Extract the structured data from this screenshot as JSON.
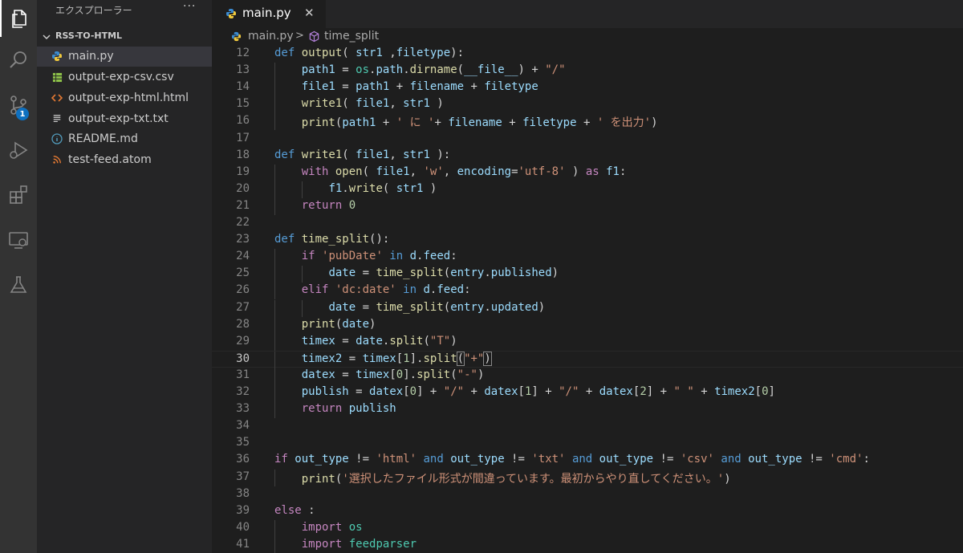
{
  "sidebar": {
    "title": "エクスプローラー",
    "more": "···",
    "folder": "RSS-TO-HTML",
    "files": [
      {
        "name": "main.py",
        "icon": "python-icon",
        "selected": true
      },
      {
        "name": "output-exp-csv.csv",
        "icon": "csv-icon"
      },
      {
        "name": "output-exp-html.html",
        "icon": "html-icon"
      },
      {
        "name": "output-exp-txt.txt",
        "icon": "text-file-icon"
      },
      {
        "name": "README.md",
        "icon": "info-icon"
      },
      {
        "name": "test-feed.atom",
        "icon": "rss-icon"
      }
    ]
  },
  "activity": {
    "scm_badge": "1",
    "items": [
      "explorer-icon",
      "search-icon",
      "source-control-icon",
      "run-debug-icon",
      "extensions-icon",
      "remote-explorer-icon",
      "testing-icon"
    ]
  },
  "tab": {
    "label": "main.py",
    "close": "✕"
  },
  "breadcrumb": {
    "file": "main.py",
    "separator": ">",
    "symbol": "time_split"
  },
  "editor": {
    "current_line": 30,
    "lines": [
      {
        "n": "12",
        "indent": 0,
        "tokens": [
          [
            "kw",
            "def "
          ],
          [
            "fn",
            "output"
          ],
          [
            "df",
            "( "
          ],
          [
            "vr",
            "str1"
          ],
          [
            "df",
            " ,"
          ],
          [
            "vr",
            "filetype"
          ],
          [
            "df",
            "):"
          ]
        ]
      },
      {
        "n": "13",
        "indent": 1,
        "tokens": [
          [
            "vr",
            "path1"
          ],
          [
            "df",
            " = "
          ],
          [
            "cls",
            "os"
          ],
          [
            "df",
            "."
          ],
          [
            "vr",
            "path"
          ],
          [
            "df",
            "."
          ],
          [
            "fn",
            "dirname"
          ],
          [
            "df",
            "("
          ],
          [
            "vr",
            "__file__"
          ],
          [
            "df",
            ") + "
          ],
          [
            "st",
            "\"/\""
          ]
        ]
      },
      {
        "n": "14",
        "indent": 1,
        "tokens": [
          [
            "vr",
            "file1"
          ],
          [
            "df",
            " = "
          ],
          [
            "vr",
            "path1"
          ],
          [
            "df",
            " + "
          ],
          [
            "vr",
            "filename"
          ],
          [
            "df",
            " + "
          ],
          [
            "vr",
            "filetype"
          ]
        ]
      },
      {
        "n": "15",
        "indent": 1,
        "tokens": [
          [
            "fn",
            "write1"
          ],
          [
            "df",
            "( "
          ],
          [
            "vr",
            "file1"
          ],
          [
            "df",
            ", "
          ],
          [
            "vr",
            "str1"
          ],
          [
            "df",
            " )"
          ]
        ]
      },
      {
        "n": "16",
        "indent": 1,
        "tokens": [
          [
            "fn",
            "print"
          ],
          [
            "df",
            "("
          ],
          [
            "vr",
            "path1"
          ],
          [
            "df",
            " + "
          ],
          [
            "st",
            "' に '"
          ],
          [
            "df",
            "+ "
          ],
          [
            "vr",
            "filename"
          ],
          [
            "df",
            " + "
          ],
          [
            "vr",
            "filetype"
          ],
          [
            "df",
            " + "
          ],
          [
            "st",
            "' を出力'"
          ],
          [
            "df",
            ")"
          ]
        ]
      },
      {
        "n": "17",
        "indent": 0,
        "tokens": []
      },
      {
        "n": "18",
        "indent": 0,
        "tokens": [
          [
            "kw",
            "def "
          ],
          [
            "fn",
            "write1"
          ],
          [
            "df",
            "( "
          ],
          [
            "vr",
            "file1"
          ],
          [
            "df",
            ", "
          ],
          [
            "vr",
            "str1"
          ],
          [
            "df",
            " ):"
          ]
        ]
      },
      {
        "n": "19",
        "indent": 1,
        "tokens": [
          [
            "ctl",
            "with "
          ],
          [
            "fn",
            "open"
          ],
          [
            "df",
            "( "
          ],
          [
            "vr",
            "file1"
          ],
          [
            "df",
            ", "
          ],
          [
            "st",
            "'w'"
          ],
          [
            "df",
            ", "
          ],
          [
            "vr",
            "encoding"
          ],
          [
            "df",
            "="
          ],
          [
            "st",
            "'utf-8'"
          ],
          [
            "df",
            " ) "
          ],
          [
            "ctl",
            "as "
          ],
          [
            "vr",
            "f1"
          ],
          [
            "df",
            ":"
          ]
        ]
      },
      {
        "n": "20",
        "indent": 2,
        "tokens": [
          [
            "vr",
            "f1"
          ],
          [
            "df",
            "."
          ],
          [
            "fn",
            "write"
          ],
          [
            "df",
            "( "
          ],
          [
            "vr",
            "str1"
          ],
          [
            "df",
            " )"
          ]
        ]
      },
      {
        "n": "21",
        "indent": 1,
        "tokens": [
          [
            "ctl",
            "return "
          ],
          [
            "nm",
            "0"
          ]
        ]
      },
      {
        "n": "22",
        "indent": 0,
        "tokens": []
      },
      {
        "n": "23",
        "indent": 0,
        "tokens": [
          [
            "kw",
            "def "
          ],
          [
            "fn",
            "time_split"
          ],
          [
            "df",
            "():"
          ]
        ]
      },
      {
        "n": "24",
        "indent": 1,
        "tokens": [
          [
            "ctl",
            "if "
          ],
          [
            "st",
            "'pubDate'"
          ],
          [
            "df",
            " "
          ],
          [
            "kw",
            "in "
          ],
          [
            "vr",
            "d"
          ],
          [
            "df",
            "."
          ],
          [
            "vr",
            "feed"
          ],
          [
            "df",
            ":"
          ]
        ]
      },
      {
        "n": "25",
        "indent": 2,
        "tokens": [
          [
            "vr",
            "date"
          ],
          [
            "df",
            " = "
          ],
          [
            "fn",
            "time_split"
          ],
          [
            "df",
            "("
          ],
          [
            "vr",
            "entry"
          ],
          [
            "df",
            "."
          ],
          [
            "vr",
            "published"
          ],
          [
            "df",
            ")"
          ]
        ]
      },
      {
        "n": "26",
        "indent": 1,
        "tokens": [
          [
            "ctl",
            "elif "
          ],
          [
            "st",
            "'dc:date'"
          ],
          [
            "df",
            " "
          ],
          [
            "kw",
            "in "
          ],
          [
            "vr",
            "d"
          ],
          [
            "df",
            "."
          ],
          [
            "vr",
            "feed"
          ],
          [
            "df",
            ":"
          ]
        ]
      },
      {
        "n": "27",
        "indent": 2,
        "tokens": [
          [
            "vr",
            "date"
          ],
          [
            "df",
            " = "
          ],
          [
            "fn",
            "time_split"
          ],
          [
            "df",
            "("
          ],
          [
            "vr",
            "entry"
          ],
          [
            "df",
            "."
          ],
          [
            "vr",
            "updated"
          ],
          [
            "df",
            ")"
          ]
        ]
      },
      {
        "n": "28",
        "indent": 1,
        "tokens": [
          [
            "fn",
            "print"
          ],
          [
            "df",
            "("
          ],
          [
            "vr",
            "date"
          ],
          [
            "df",
            ")"
          ]
        ]
      },
      {
        "n": "29",
        "indent": 1,
        "tokens": [
          [
            "vr",
            "timex"
          ],
          [
            "df",
            " = "
          ],
          [
            "vr",
            "date"
          ],
          [
            "df",
            "."
          ],
          [
            "fn",
            "split"
          ],
          [
            "df",
            "("
          ],
          [
            "st",
            "\"T\""
          ],
          [
            "df",
            ")"
          ]
        ]
      },
      {
        "n": "30",
        "indent": 1,
        "tokens": [
          [
            "vr",
            "timex2"
          ],
          [
            "df",
            " = "
          ],
          [
            "vr",
            "timex"
          ],
          [
            "df",
            "["
          ],
          [
            "nm",
            "1"
          ],
          [
            "df",
            "]."
          ],
          [
            "fn",
            "split"
          ],
          [
            "bm",
            "("
          ],
          [
            "st",
            "\"+\""
          ],
          [
            "bm",
            ")"
          ]
        ]
      },
      {
        "n": "31",
        "indent": 1,
        "tokens": [
          [
            "vr",
            "datex"
          ],
          [
            "df",
            " = "
          ],
          [
            "vr",
            "timex"
          ],
          [
            "df",
            "["
          ],
          [
            "nm",
            "0"
          ],
          [
            "df",
            "]."
          ],
          [
            "fn",
            "split"
          ],
          [
            "df",
            "("
          ],
          [
            "st",
            "\"-\""
          ],
          [
            "df",
            ")"
          ]
        ]
      },
      {
        "n": "32",
        "indent": 1,
        "tokens": [
          [
            "vr",
            "publish"
          ],
          [
            "df",
            " = "
          ],
          [
            "vr",
            "datex"
          ],
          [
            "df",
            "["
          ],
          [
            "nm",
            "0"
          ],
          [
            "df",
            "] + "
          ],
          [
            "st",
            "\"/\""
          ],
          [
            "df",
            " + "
          ],
          [
            "vr",
            "datex"
          ],
          [
            "df",
            "["
          ],
          [
            "nm",
            "1"
          ],
          [
            "df",
            "] + "
          ],
          [
            "st",
            "\"/\""
          ],
          [
            "df",
            " + "
          ],
          [
            "vr",
            "datex"
          ],
          [
            "df",
            "["
          ],
          [
            "nm",
            "2"
          ],
          [
            "df",
            "] + "
          ],
          [
            "st",
            "\" \""
          ],
          [
            "df",
            " + "
          ],
          [
            "vr",
            "timex2"
          ],
          [
            "df",
            "["
          ],
          [
            "nm",
            "0"
          ],
          [
            "df",
            "]"
          ]
        ]
      },
      {
        "n": "33",
        "indent": 1,
        "tokens": [
          [
            "ctl",
            "return "
          ],
          [
            "vr",
            "publish"
          ]
        ]
      },
      {
        "n": "34",
        "indent": 0,
        "tokens": []
      },
      {
        "n": "35",
        "indent": 0,
        "tokens": []
      },
      {
        "n": "36",
        "indent": 0,
        "tokens": [
          [
            "ctl",
            "if "
          ],
          [
            "vr",
            "out_type"
          ],
          [
            "df",
            " != "
          ],
          [
            "st",
            "'html'"
          ],
          [
            "df",
            " "
          ],
          [
            "kw",
            "and "
          ],
          [
            "vr",
            "out_type"
          ],
          [
            "df",
            " != "
          ],
          [
            "st",
            "'txt'"
          ],
          [
            "df",
            " "
          ],
          [
            "kw",
            "and "
          ],
          [
            "vr",
            "out_type"
          ],
          [
            "df",
            " != "
          ],
          [
            "st",
            "'csv'"
          ],
          [
            "df",
            " "
          ],
          [
            "kw",
            "and "
          ],
          [
            "vr",
            "out_type"
          ],
          [
            "df",
            " != "
          ],
          [
            "st",
            "'cmd'"
          ],
          [
            "df",
            ":"
          ]
        ]
      },
      {
        "n": "37",
        "indent": 1,
        "tokens": [
          [
            "fn",
            "print"
          ],
          [
            "df",
            "("
          ],
          [
            "st",
            "'選択したファイル形式が間違っています。最初からやり直してください。'"
          ],
          [
            "df",
            ")"
          ]
        ]
      },
      {
        "n": "38",
        "indent": 0,
        "tokens": []
      },
      {
        "n": "39",
        "indent": 0,
        "tokens": [
          [
            "ctl",
            "else "
          ],
          [
            "df",
            ":"
          ]
        ]
      },
      {
        "n": "40",
        "indent": 1,
        "tokens": [
          [
            "ctl",
            "import "
          ],
          [
            "cls",
            "os"
          ]
        ]
      },
      {
        "n": "41",
        "indent": 1,
        "tokens": [
          [
            "ctl",
            "import "
          ],
          [
            "cls",
            "feedparser"
          ]
        ]
      }
    ]
  }
}
